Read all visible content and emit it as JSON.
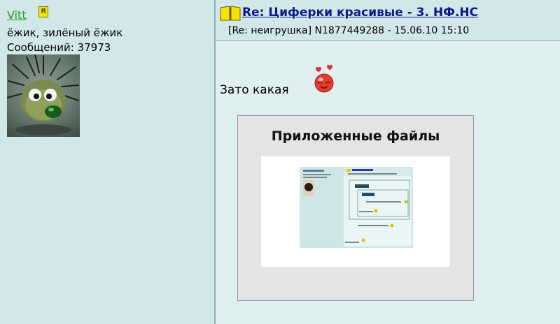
{
  "user": {
    "name": "Vitt",
    "badge": "M",
    "title": "ёжик, зилёный ёжик",
    "posts": "Сообщений: 37973"
  },
  "post": {
    "title": "Re: Циферки красивые - 3. НФ.НС",
    "meta": "[Re: неигрушка]  N1877449288 - 15.06.10 15:10",
    "body": "Зато какая"
  },
  "attachments": {
    "title": "Приложенные файлы"
  },
  "colors": {
    "username": "#1e9e1e",
    "title_link": "#0a1a8a",
    "panel": "#d2e8e8",
    "badge": "#f3e600"
  },
  "icons": [
    "moderator-badge-icon",
    "book-icon",
    "love-smiley-icon"
  ]
}
